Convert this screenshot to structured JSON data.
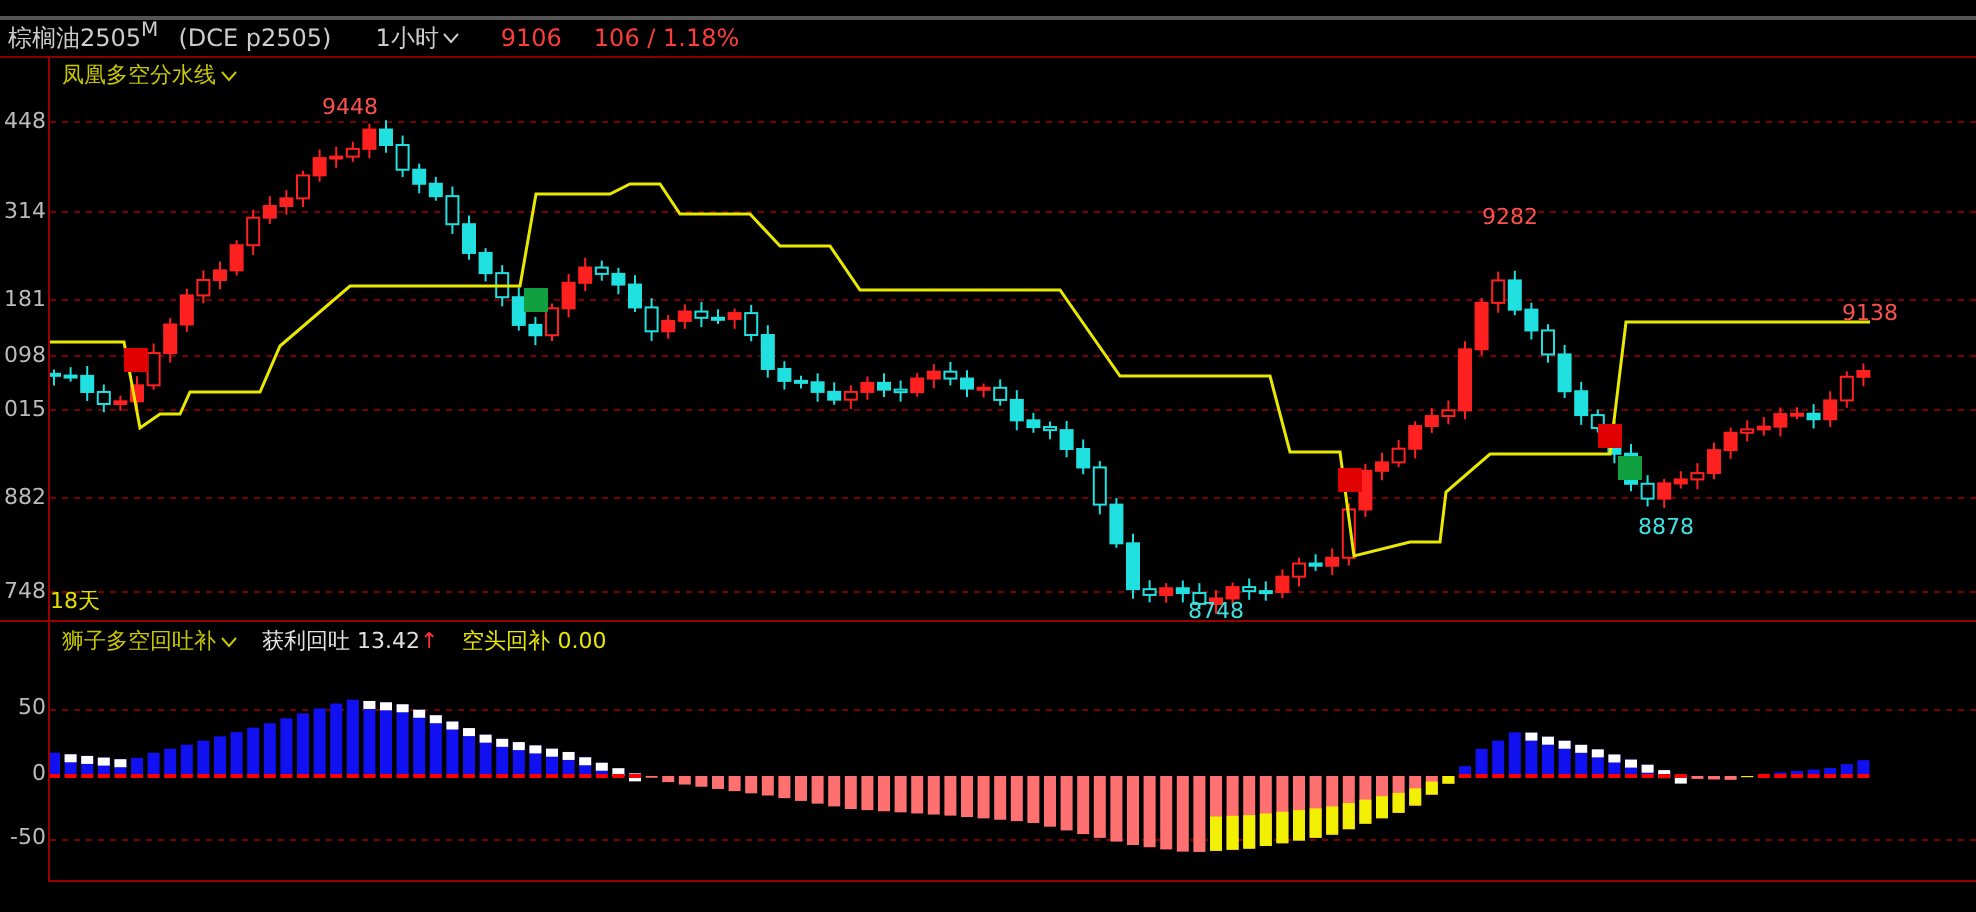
{
  "header": {
    "symbol": "棕榈油2505$^{M}$",
    "exchange": "(DCE p2505)",
    "period": "1小时",
    "price": "9106",
    "change": "106 / 1.18%"
  },
  "main_panel": {
    "indicator": "凤凰多空分水线",
    "axis_labels": [
      "448",
      "314",
      "181",
      "098",
      "015",
      "882",
      "748"
    ],
    "price_labels": [
      {
        "text": "9448",
        "kind": "high"
      },
      {
        "text": "9282",
        "kind": "high"
      },
      {
        "text": "9138",
        "kind": "high"
      },
      {
        "text": "8878",
        "kind": "low"
      },
      {
        "text": "8748",
        "kind": "low"
      }
    ],
    "footer": "18天"
  },
  "sub_panel": {
    "indicator": "狮子多空回吐补",
    "fields": [
      {
        "label": "获利回吐",
        "value": "13.42",
        "arrow": "↑",
        "color": "#e0e0e0"
      },
      {
        "label": "空头回补",
        "value": "0.00",
        "color": "#e8e800"
      }
    ],
    "axis_labels": [
      "50",
      "0",
      "-50"
    ]
  }
}
